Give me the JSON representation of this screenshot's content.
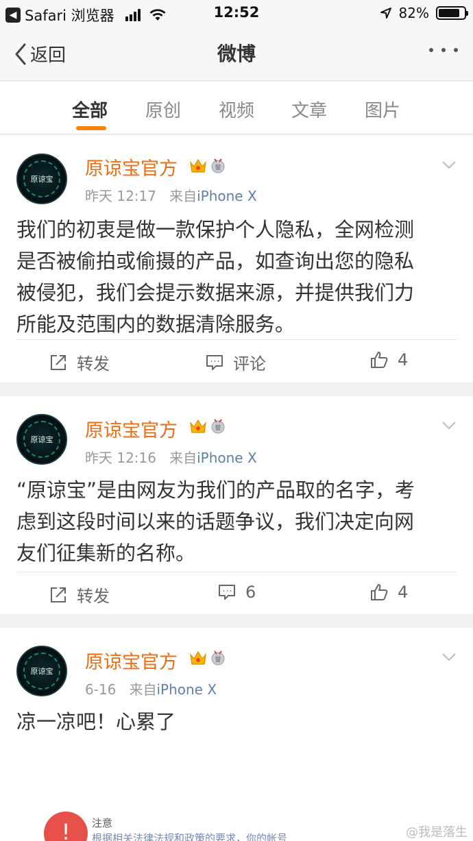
{
  "status_bar": {
    "app": "Safari 浏览器",
    "time": "12:52",
    "battery_pct": "82%",
    "battery_level": 0.82
  },
  "nav": {
    "back_label": "返回",
    "title": "微博"
  },
  "tabs": [
    {
      "label": "全部",
      "active": true
    },
    {
      "label": "原创",
      "active": false
    },
    {
      "label": "视频",
      "active": false
    },
    {
      "label": "文章",
      "active": false
    },
    {
      "label": "图片",
      "active": false
    }
  ],
  "posts": [
    {
      "avatar_text": "原谅宝",
      "username": "原谅宝官方",
      "time": "昨天 12:17",
      "via": "来自",
      "source": "iPhone X",
      "lines": [
        "我们的初衷是做一款保护个人隐私，全网检测",
        "是否被偷拍或偷摄的产品，如查询出您的隐私",
        "被侵犯，我们会提示数据来源，并提供我们力",
        "所能及范围内的数据清除服务。"
      ],
      "repost_label": "转发",
      "comment_label": "评论",
      "like_count": "4"
    },
    {
      "avatar_text": "原谅宝",
      "username": "原谅宝官方",
      "time": "昨天 12:16",
      "via": "来自",
      "source": "iPhone X",
      "lines": [
        "“原谅宝”是由网友为我们的产品取的名字，考",
        "虑到这段时间以来的话题争议，我们决定向网",
        "友们征集新的名称。"
      ],
      "repost_label": "转发",
      "comment_label": "6",
      "like_count": "4"
    },
    {
      "avatar_text": "原谅宝",
      "username": "原谅宝官方",
      "time": "6-16",
      "via": "来自",
      "source": "iPhone X",
      "lines": [
        "凉一凉吧！心累了"
      ]
    }
  ],
  "notice": {
    "badge": "!",
    "title": "注意",
    "text": "根据相关法律法规和政策的要求，你的帐号"
  },
  "watermark": "@我是落生",
  "colors": {
    "accent": "#ff8200",
    "username": "#f26b10",
    "source": "#5d7fa8",
    "notice_badge": "#e8504a"
  }
}
